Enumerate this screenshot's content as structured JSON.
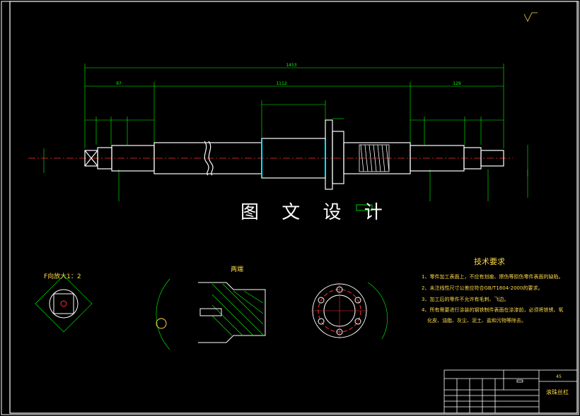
{
  "watermark": "图 文 设 计",
  "labels": {
    "view_f": "F向放大1：2",
    "view_ends": "两端"
  },
  "dimensions": {
    "overall": "1453",
    "left": "97",
    "middle": "1112",
    "right": "129"
  },
  "tech_requirements": {
    "title": "技术要求",
    "items": [
      "1、零件加工表面上，不应有划痕、擦伤等损伤零件表面的缺陷。",
      "2、未注线性尺寸公差应符合GB/T1804-2000的要求。",
      "3、加工后的零件不允许有毛刺、飞边。",
      "4、所有需要进行涂装的钢铁制件表面在涂漆前，必须将铁锈、氧",
      "化皮、油脂、灰尘、泥土、盐和污物等除去。"
    ]
  },
  "title_block": {
    "part_name": "滚珠丝杠",
    "material": "45"
  },
  "colors": {
    "background": "#000000",
    "frame": "#ffffff",
    "dimension": "#00ff00",
    "text": "#ffd84a",
    "part": "#ffffff",
    "centerline": "#ff3030",
    "highlight": "#00e5ff"
  }
}
